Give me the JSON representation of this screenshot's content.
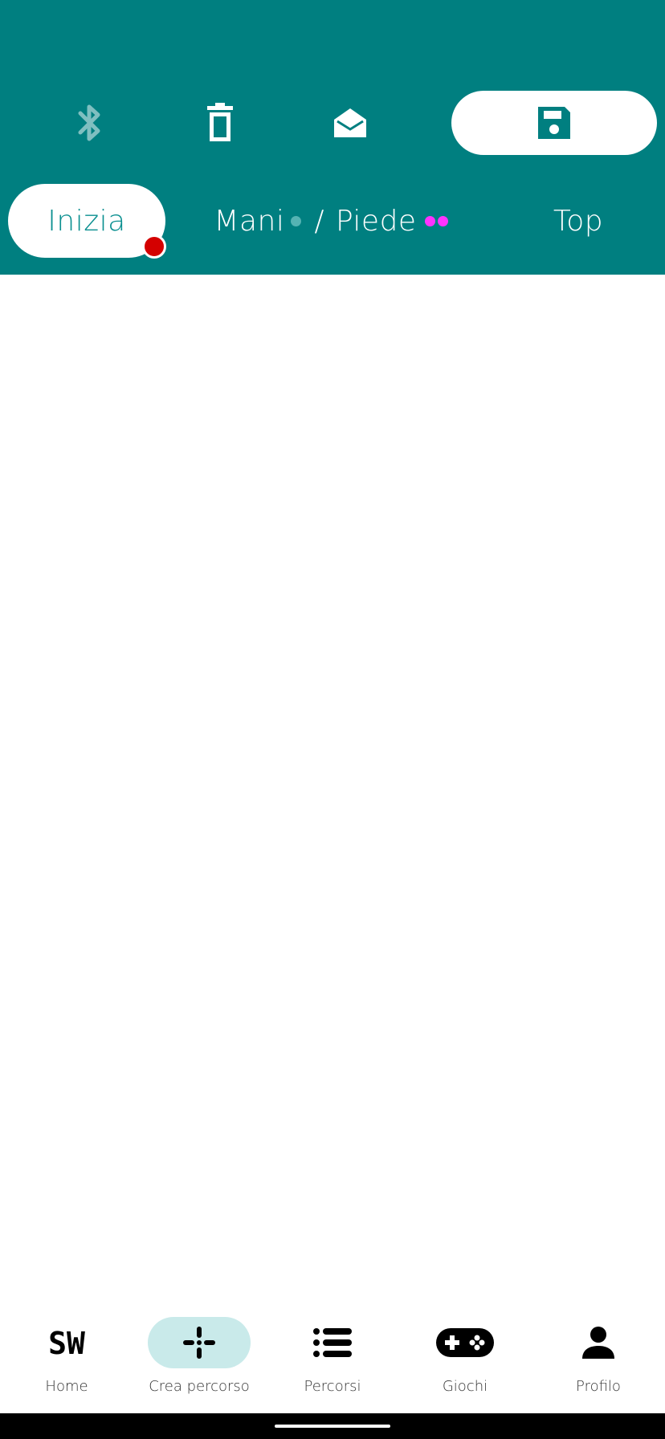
{
  "header": {
    "background": "#007f80",
    "actions": [
      {
        "icon": "bluetooth-icon",
        "enabled": false
      },
      {
        "icon": "trash-icon",
        "enabled": true
      },
      {
        "icon": "envelope-open-icon",
        "enabled": true
      },
      {
        "icon": "save-icon",
        "enabled": true
      }
    ],
    "tabs": {
      "inizia": "Inizia",
      "mani": "Mani",
      "separator": "/",
      "piede": "Piede",
      "top": "Top"
    },
    "dot_colors": {
      "alert": "#d40000",
      "mani": "#55b3b3",
      "piede": "#ff33ff"
    }
  },
  "bottom_nav": {
    "items": [
      {
        "label": "Home",
        "icon": "sw-logo-icon",
        "active": false
      },
      {
        "label": "Crea percorso",
        "icon": "plus-cross-icon",
        "active": true
      },
      {
        "label": "Percorsi",
        "icon": "list-icon",
        "active": false
      },
      {
        "label": "Giochi",
        "icon": "gamepad-icon",
        "active": false
      },
      {
        "label": "Profilo",
        "icon": "person-icon",
        "active": false
      }
    ]
  }
}
